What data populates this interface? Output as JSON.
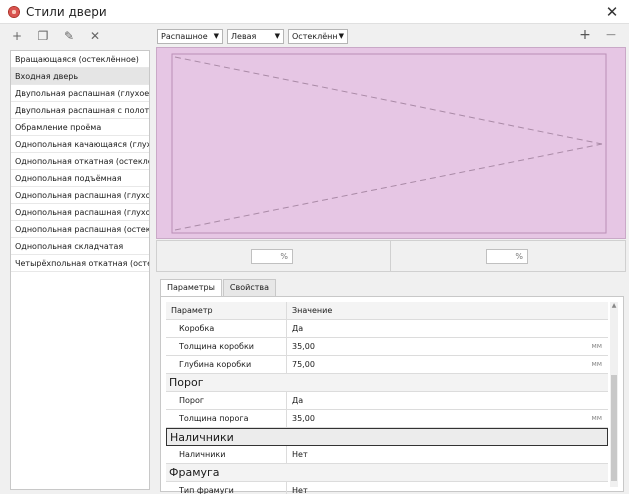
{
  "window": {
    "title": "Стили двери"
  },
  "left_toolbar": {
    "buttons": [
      {
        "name": "add-style-button",
        "icon": "plus-icon",
        "glyph": "+"
      },
      {
        "name": "copy-style-button",
        "icon": "copy-icon",
        "glyph": "❐"
      },
      {
        "name": "edit-style-button",
        "icon": "pencil-icon",
        "glyph": "✎"
      },
      {
        "name": "delete-style-button",
        "icon": "cross-icon",
        "glyph": "✕"
      }
    ]
  },
  "styles": [
    "Вращающаяся (остеклённое)",
    "Входная дверь",
    "Двупольная распашная (глухое)",
    "Двупольная распашная с полотна",
    "Обрамление проёма",
    "Однопольная качающаяся (глухое",
    "Однопольная откатная (остеклённ",
    "Однопольная подъёмная",
    "Однопольная распашная (глухое с",
    "Однопольная распашная (глухое т",
    "Однопольная распашная (остекле",
    "Однопольная складчатая",
    "Четырёхпольная откатная (остекл"
  ],
  "selected_style_index": 1,
  "top_toolbar": {
    "opening_type": "Распашное",
    "hand": "Левая",
    "fill": "Остеклённ",
    "add_glyph": "+",
    "remove_glyph": "−"
  },
  "preview": {
    "background": "#e6c6e4"
  },
  "percent": {
    "left": "%",
    "right": "%"
  },
  "tabs": [
    {
      "label": "Параметры",
      "active": true
    },
    {
      "label": "Свойства",
      "active": false
    }
  ],
  "grid": {
    "header": {
      "param": "Параметр",
      "value": "Значение"
    },
    "r1": {
      "name": "Коробка",
      "value": "Да"
    },
    "r2": {
      "name": "Толщина коробки",
      "value": "35,00",
      "unit": "мм"
    },
    "r3": {
      "name": "Глубина коробки",
      "value": "75,00",
      "unit": "мм"
    },
    "g1": "Порог",
    "r4": {
      "name": "Порог",
      "value": "Да"
    },
    "r5": {
      "name": "Толщина порога",
      "value": "35,00",
      "unit": "мм"
    },
    "g2": "Наличники",
    "r6": {
      "name": "Наличники",
      "value": "Нет"
    },
    "g3": "Фрамуга",
    "r7": {
      "name": "Тип фрамуги",
      "value": "Нет"
    }
  }
}
